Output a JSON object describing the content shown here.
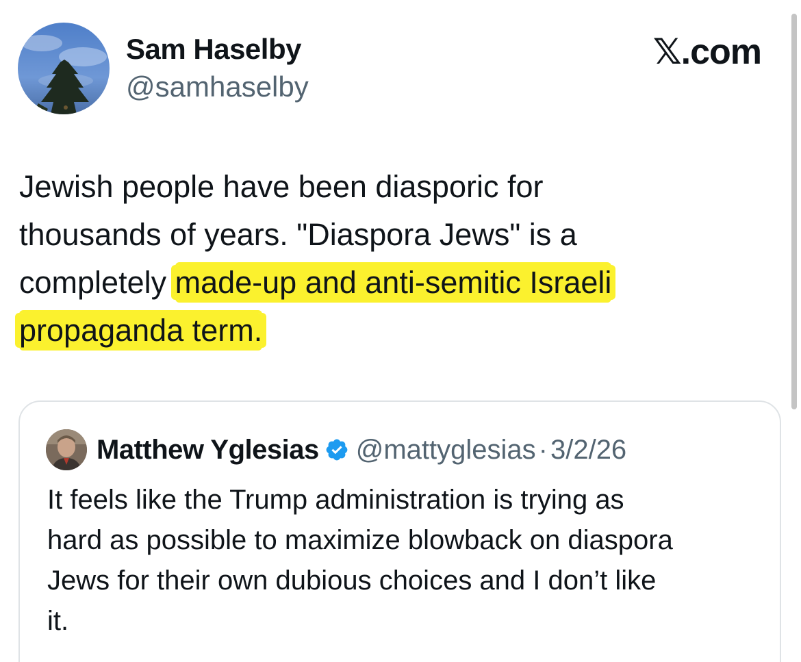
{
  "brand": {
    "mark": "𝕏",
    "suffix": ".com"
  },
  "author": {
    "name": "Sam Haselby",
    "handle": "@samhaselby"
  },
  "tweet": {
    "line1": "Jewish people have been diasporic for",
    "line2": "thousands of years. \"Diaspora Jews\" is a",
    "line3_plain": "completely ",
    "line3_highlight": "made-up and anti-semitic Israeli",
    "line4_highlight": "propaganda term."
  },
  "highlight_color": "#fbf12e",
  "quoted": {
    "name": "Matthew Yglesias",
    "verified_icon": "verified-badge-icon",
    "handle": "@mattyglesias",
    "separator": "·",
    "date": "3/2/26",
    "line1": "It feels like the Trump administration is trying as",
    "line2": "hard as possible to maximize blowback on diaspora",
    "line3": "Jews for their own dubious choices and I don’t like",
    "line4": "it."
  },
  "colors": {
    "text": "#0f1419",
    "secondary": "#536471",
    "verified": "#1d9bf0",
    "border": "#dfe3e6"
  }
}
